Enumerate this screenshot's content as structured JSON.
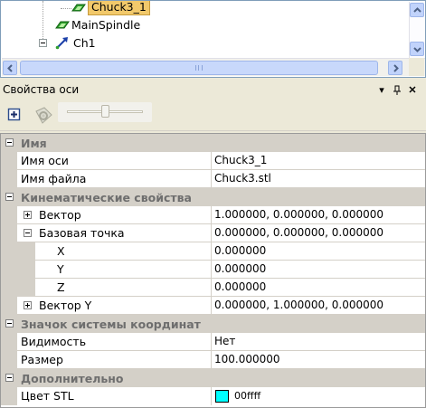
{
  "tree": {
    "nodes": [
      {
        "label": "Chuck3_1",
        "selected": true
      },
      {
        "label": "MainSpindle",
        "selected": false
      },
      {
        "label": "Ch1",
        "selected": false
      }
    ]
  },
  "panel": {
    "title": "Свойства оси",
    "pin_glyph": "▾",
    "autohide_glyph": "⊥",
    "close_glyph": "✕"
  },
  "grid": {
    "sections": [
      {
        "title": "Имя",
        "rows": [
          {
            "name": "Имя оси",
            "value": "Chuck3_1"
          },
          {
            "name": "Имя файла",
            "value": "Chuck3.stl"
          }
        ]
      },
      {
        "title": "Кинематические свойства",
        "rows": [
          {
            "name": "Вектор",
            "value": "1.000000, 0.000000, 0.000000",
            "expandable": true,
            "expanded": false
          },
          {
            "name": "Базовая точка",
            "value": "0.000000, 0.000000, 0.000000",
            "expandable": true,
            "expanded": true
          },
          {
            "name": "X",
            "value": "0.000000",
            "child": true
          },
          {
            "name": "Y",
            "value": "0.000000",
            "child": true
          },
          {
            "name": "Z",
            "value": "0.000000",
            "child": true
          },
          {
            "name": "Вектор Y",
            "value": "0.000000, 1.000000, 0.000000",
            "expandable": true,
            "expanded": false
          }
        ]
      },
      {
        "title": "Значок системы координат",
        "rows": [
          {
            "name": "Видимость",
            "value": "Нет"
          },
          {
            "name": "Размер",
            "value": "100.000000"
          }
        ]
      },
      {
        "title": "Дополнительно",
        "rows": [
          {
            "name": "Цвет STL",
            "value": "00ffff",
            "color": "#00ffff"
          }
        ]
      }
    ]
  },
  "colors": {
    "selection": "#f2c96b",
    "category_bg": "#d4d0c8",
    "category_text": "#6e6e6e",
    "stl_color": "#00ffff"
  }
}
